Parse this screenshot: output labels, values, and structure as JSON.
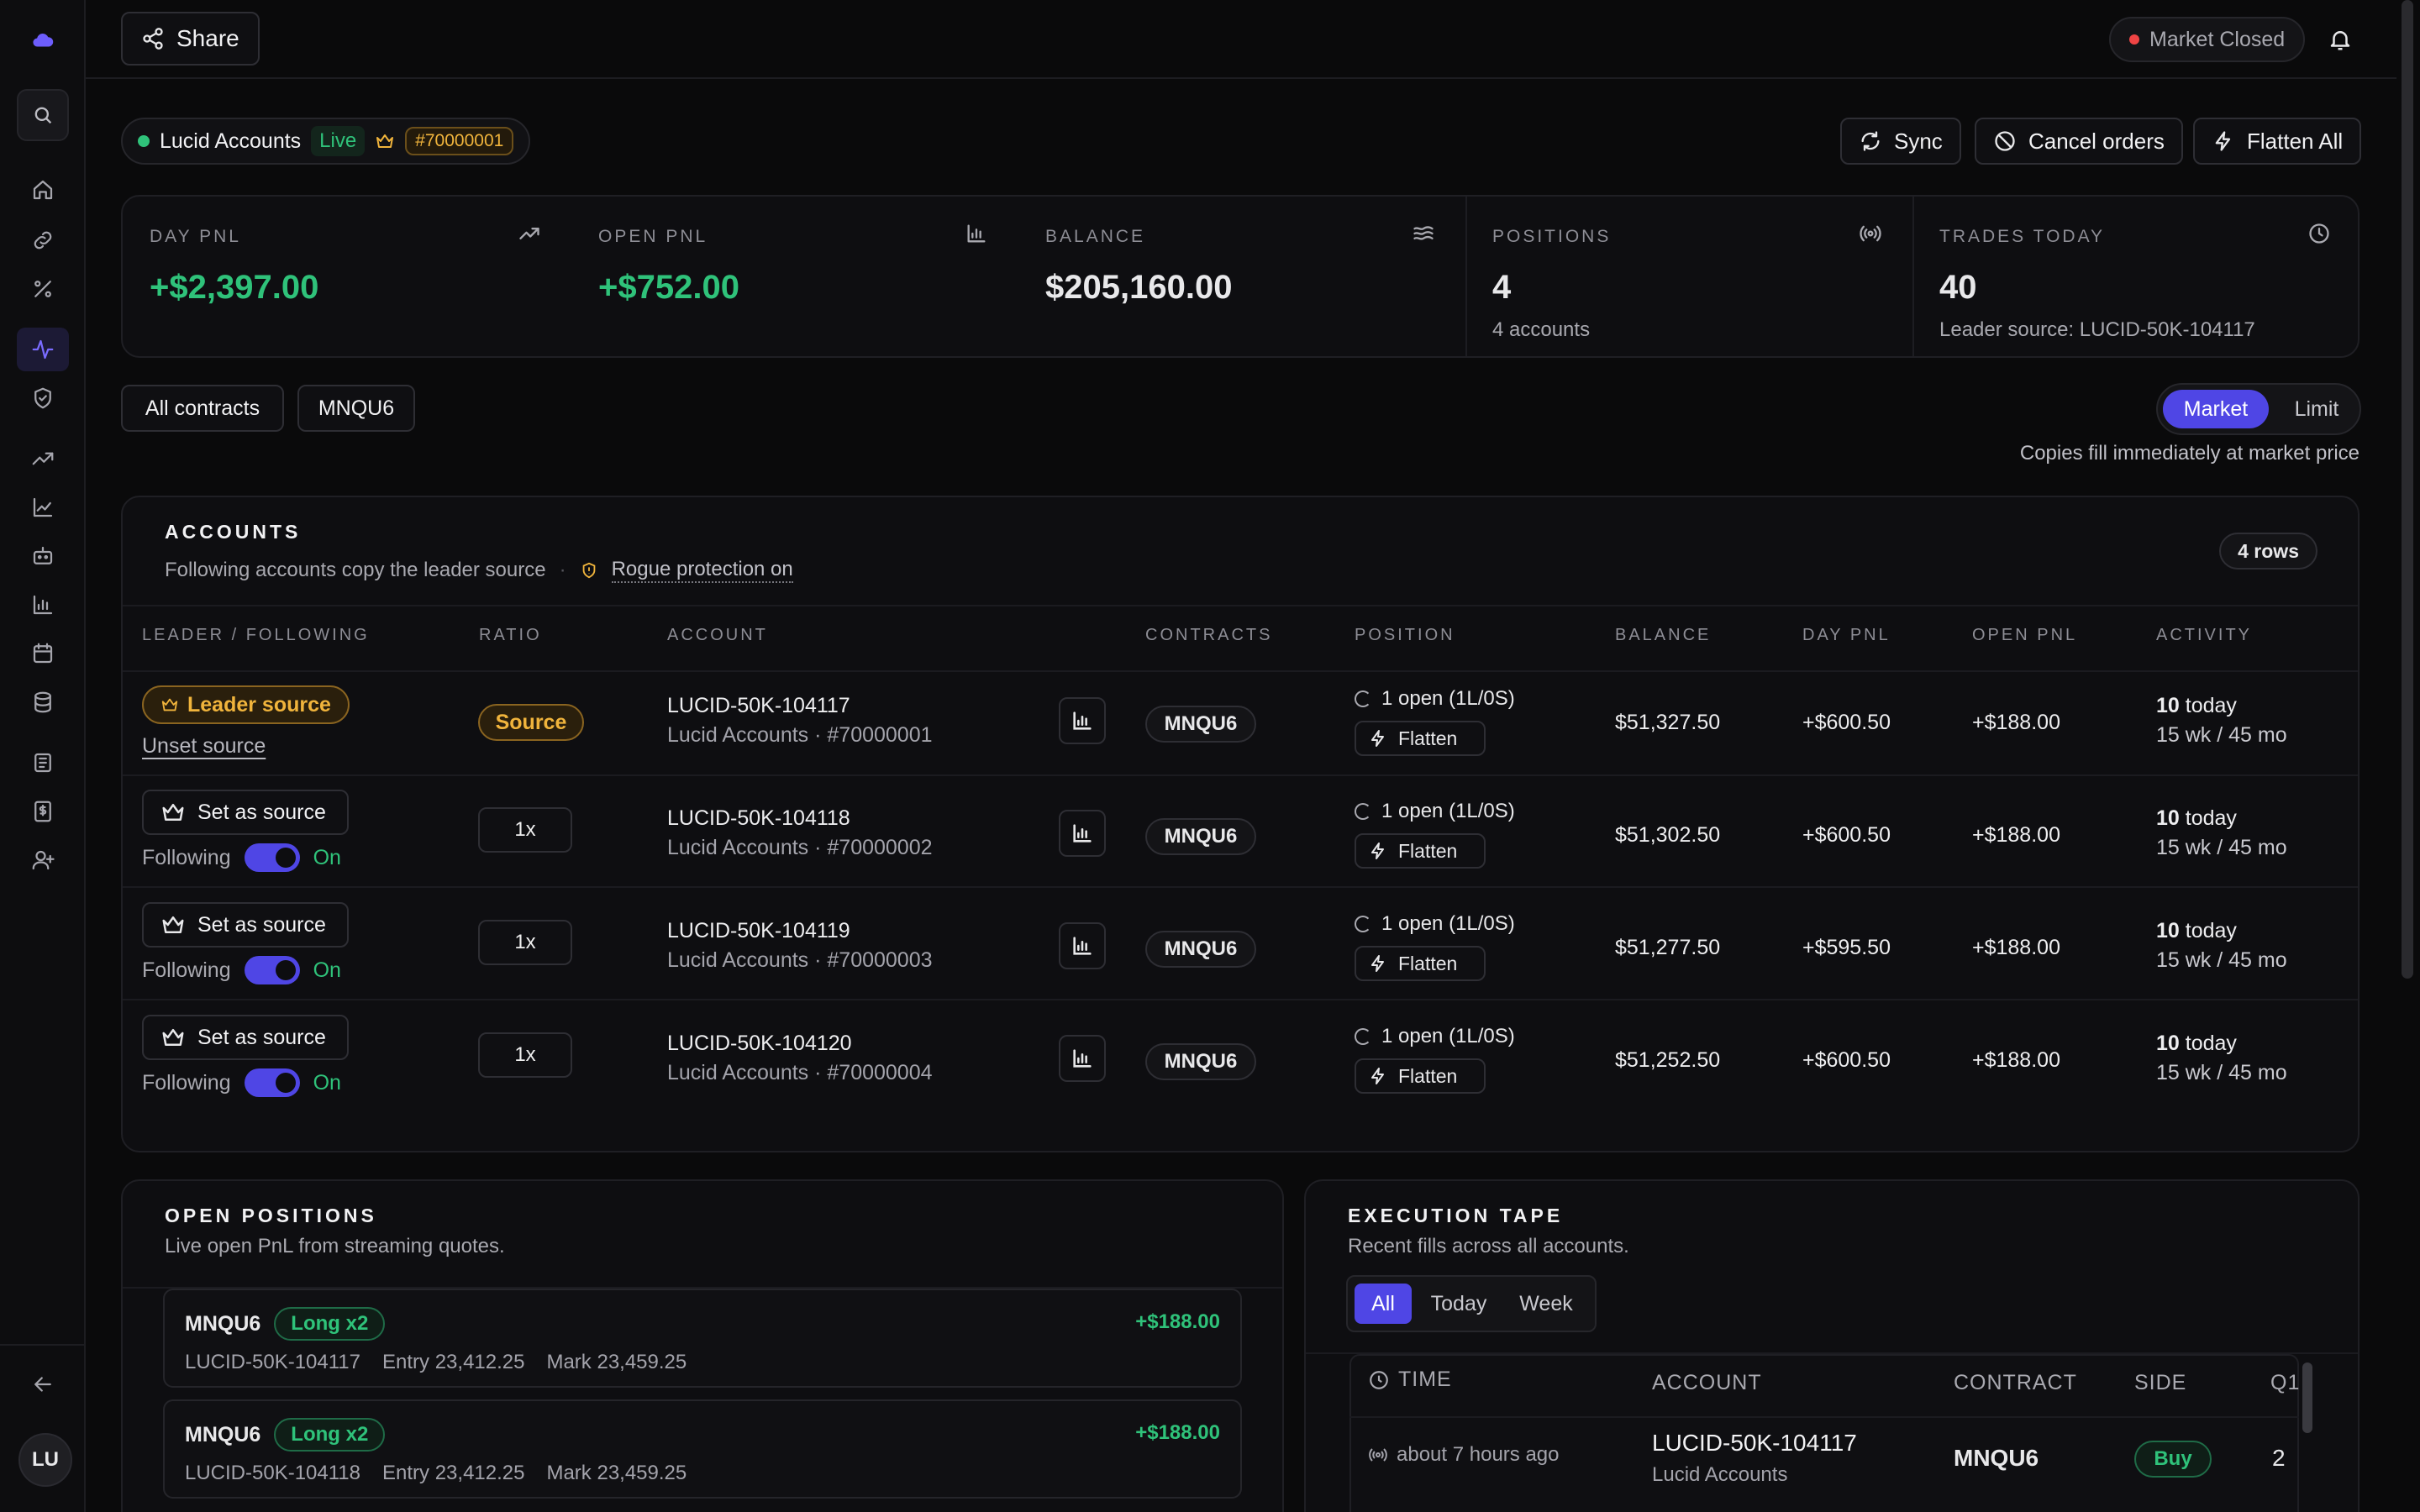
{
  "topbar": {
    "share_label": "Share",
    "market_status": "Market Closed"
  },
  "account": {
    "name": "Lucid Accounts",
    "status": "Live",
    "id": "#70000001"
  },
  "actions": {
    "sync": "Sync",
    "cancel": "Cancel orders",
    "flatten_all": "Flatten All"
  },
  "stats": [
    {
      "label": "DAY PNL",
      "value": "+$2,397.00",
      "sub": ""
    },
    {
      "label": "OPEN PNL",
      "value": "+$752.00",
      "sub": ""
    },
    {
      "label": "BALANCE",
      "value": "$205,160.00",
      "sub": ""
    },
    {
      "label": "POSITIONS",
      "value": "4",
      "sub": "4 accounts"
    },
    {
      "label": "TRADES TODAY",
      "value": "40",
      "sub": "Leader source: LUCID-50K-104117"
    }
  ],
  "filters": {
    "all": "All contracts",
    "contract": "MNQU6",
    "market": "Market",
    "limit": "Limit",
    "hint": "Copies fill immediately at market price"
  },
  "accounts": {
    "title": "ACCOUNTS",
    "subtitle": "Following accounts copy the leader source",
    "rogue": "Rogue protection on",
    "rows_badge": "4 rows",
    "headers": [
      "LEADER / FOLLOWING",
      "RATIO",
      "ACCOUNT",
      "CONTRACTS",
      "POSITION",
      "BALANCE",
      "DAY PNL",
      "OPEN PNL",
      "ACTIVITY"
    ],
    "leader_label": "Leader source",
    "unset_label": "Unset source",
    "source_label": "Source",
    "set_source_label": "Set as source",
    "following_label": "Following",
    "on_label": "On",
    "flatten_label": "Flatten",
    "rows": [
      {
        "ratio": "Source",
        "account": "LUCID-50K-104117",
        "acct_sub": "Lucid Accounts · #70000001",
        "contract": "MNQU6",
        "position": "1 open (1L/0S)",
        "balance": "$51,327.50",
        "day_pnl": "+$600.50",
        "open_pnl": "+$188.00",
        "activity_n": "10",
        "activity_t": "today",
        "activity_sub": "15 wk / 45 mo"
      },
      {
        "ratio": "1x",
        "account": "LUCID-50K-104118",
        "acct_sub": "Lucid Accounts · #70000002",
        "contract": "MNQU6",
        "position": "1 open (1L/0S)",
        "balance": "$51,302.50",
        "day_pnl": "+$600.50",
        "open_pnl": "+$188.00",
        "activity_n": "10",
        "activity_t": "today",
        "activity_sub": "15 wk / 45 mo"
      },
      {
        "ratio": "1x",
        "account": "LUCID-50K-104119",
        "acct_sub": "Lucid Accounts · #70000003",
        "contract": "MNQU6",
        "position": "1 open (1L/0S)",
        "balance": "$51,277.50",
        "day_pnl": "+$595.50",
        "open_pnl": "+$188.00",
        "activity_n": "10",
        "activity_t": "today",
        "activity_sub": "15 wk / 45 mo"
      },
      {
        "ratio": "1x",
        "account": "LUCID-50K-104120",
        "acct_sub": "Lucid Accounts · #70000004",
        "contract": "MNQU6",
        "position": "1 open (1L/0S)",
        "balance": "$51,252.50",
        "day_pnl": "+$600.50",
        "open_pnl": "+$188.00",
        "activity_n": "10",
        "activity_t": "today",
        "activity_sub": "15 wk / 45 mo"
      }
    ]
  },
  "open_positions": {
    "title": "OPEN POSITIONS",
    "subtitle": "Live open PnL from streaming quotes.",
    "items": [
      {
        "contract": "MNQU6",
        "side": "Long x2",
        "pnl": "+$188.00",
        "account": "LUCID-50K-104117",
        "entry": "Entry 23,412.25",
        "mark": "Mark 23,459.25"
      },
      {
        "contract": "MNQU6",
        "side": "Long x2",
        "pnl": "+$188.00",
        "account": "LUCID-50K-104118",
        "entry": "Entry 23,412.25",
        "mark": "Mark 23,459.25"
      }
    ]
  },
  "tape": {
    "title": "EXECUTION TAPE",
    "subtitle": "Recent fills across all accounts.",
    "tabs": [
      "All",
      "Today",
      "Week"
    ],
    "headers": [
      "TIME",
      "ACCOUNT",
      "CONTRACT",
      "SIDE",
      "Q1"
    ],
    "rows": [
      {
        "time": "about 7 hours ago",
        "account": "LUCID-50K-104117",
        "account_sub": "Lucid Accounts",
        "contract": "MNQU6",
        "side": "Buy",
        "qty": "2"
      }
    ]
  },
  "user": {
    "initials": "LU"
  },
  "colors": {
    "accent": "#4f46e5",
    "positive": "#2fc27a",
    "leader": "#f0b43c",
    "danger": "#ef4444"
  }
}
